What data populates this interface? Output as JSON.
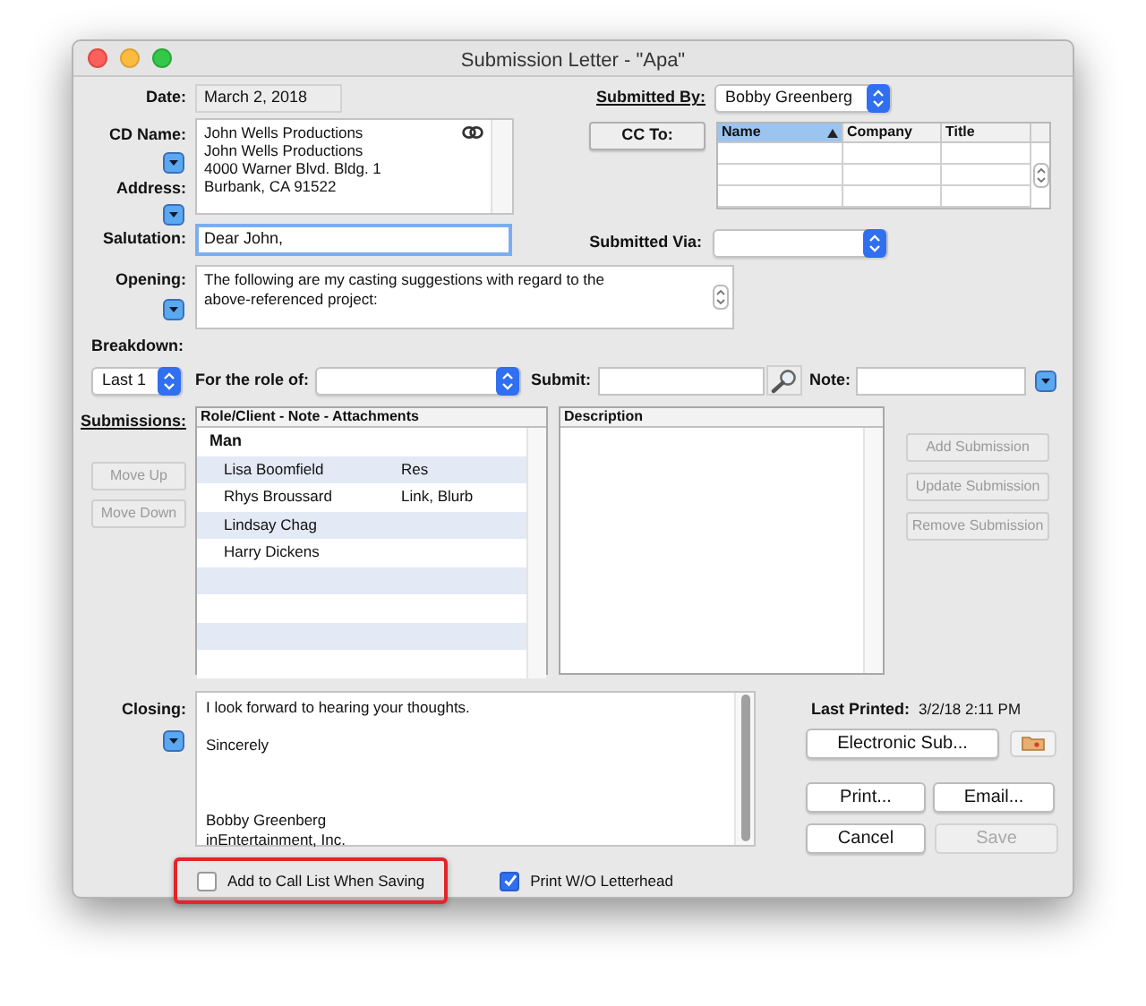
{
  "window": {
    "title": "Submission Letter - \"Apa\""
  },
  "date": {
    "label": "Date:",
    "value": "March 2, 2018"
  },
  "submitted_by": {
    "label": "Submitted By:",
    "value": "Bobby Greenberg"
  },
  "cd_name": {
    "label": "CD Name:"
  },
  "address": {
    "label": "Address:",
    "lines": [
      "John Wells Productions",
      "John Wells Productions",
      "4000 Warner Blvd. Bldg. 1",
      "Burbank, CA 91522"
    ]
  },
  "cc_to": {
    "button": "CC To:",
    "columns": [
      {
        "label": "Name",
        "sorted": true
      },
      {
        "label": "Company",
        "sorted": false
      },
      {
        "label": "Title",
        "sorted": false
      }
    ]
  },
  "salutation": {
    "label": "Salutation:",
    "value": "Dear John,",
    "focused": true
  },
  "submitted_via": {
    "label": "Submitted Via:"
  },
  "opening": {
    "label": "Opening:",
    "lines": [
      "The following are my casting suggestions with regard to the",
      "above-referenced project:"
    ]
  },
  "breakdown": {
    "label": "Breakdown:",
    "value": "Last 1"
  },
  "role": {
    "label": "For the role of:"
  },
  "submit": {
    "label": "Submit:"
  },
  "note": {
    "label": "Note:"
  },
  "submissions": {
    "label": "Submissions:",
    "move_buttons": [
      {
        "label": "Move Up",
        "disabled": true
      },
      {
        "label": "Move Down",
        "disabled": true
      }
    ],
    "header": "Role/Client - Note - Attachments",
    "rows": [
      {
        "kind": "group",
        "name": "Man"
      },
      {
        "kind": "item",
        "name": "Lisa Boomfield",
        "note": "Res"
      },
      {
        "kind": "item",
        "name": "Rhys Broussard",
        "note": "Link, Blurb"
      },
      {
        "kind": "item",
        "name": "Lindsay Chag"
      },
      {
        "kind": "item",
        "name": "Harry Dickens"
      }
    ]
  },
  "description": {
    "header": "Description"
  },
  "action_buttons": [
    {
      "label": "Add Submission",
      "disabled": true
    },
    {
      "label": "Update Submission",
      "disabled": true
    },
    {
      "label": "Remove Submission",
      "disabled": true
    }
  ],
  "closing": {
    "label": "Closing:",
    "paragraphs": [
      "I look forward to hearing your thoughts.",
      "Sincerely",
      "Bobby Greenberg\ninEntertainment, Inc."
    ]
  },
  "last_printed": {
    "label": "Last Printed:",
    "value": "3/2/18 2:11 PM"
  },
  "buttons": [
    {
      "label": "Electronic Sub...",
      "disabled": false
    },
    {
      "label": "Print...",
      "disabled": false
    },
    {
      "label": "Email...",
      "disabled": false
    },
    {
      "label": "Cancel",
      "disabled": false
    },
    {
      "label": "Save",
      "disabled": true
    }
  ],
  "options": [
    {
      "label": "Add to Call List When Saving",
      "checked": false,
      "highlighted": true
    },
    {
      "label": "Print W/O Letterhead",
      "checked": true,
      "highlighted": false
    }
  ]
}
